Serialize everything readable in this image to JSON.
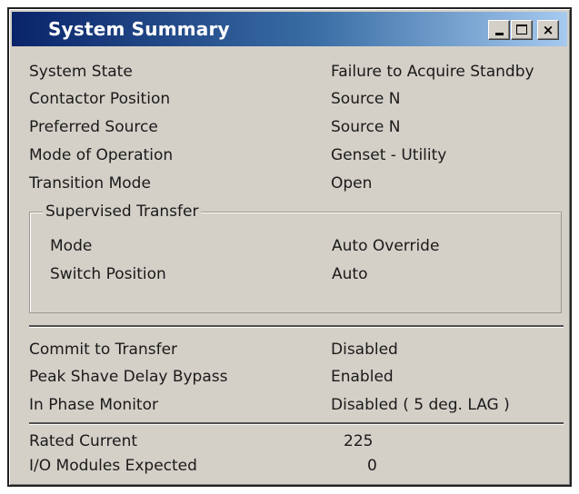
{
  "window": {
    "title": "System Summary",
    "controls": {
      "minimize": "minimize",
      "maximize": "maximize",
      "close": "×"
    }
  },
  "summary": [
    {
      "label": "System State",
      "value": "Failure to Acquire Standby"
    },
    {
      "label": "Contactor Position",
      "value": "Source N"
    },
    {
      "label": "Preferred Source",
      "value": "Source N"
    },
    {
      "label": "Mode of Operation",
      "value": "Genset - Utility"
    },
    {
      "label": "Transition Mode",
      "value": "Open"
    }
  ],
  "supervised_transfer": {
    "legend": "Supervised Transfer",
    "rows": [
      {
        "label": "Mode",
        "value": "Auto Override"
      },
      {
        "label": "Switch Position",
        "value": "Auto"
      }
    ]
  },
  "transfer_settings": [
    {
      "label": "Commit to Transfer",
      "value": "Disabled"
    },
    {
      "label": "Peak Shave Delay Bypass",
      "value": "Enabled"
    },
    {
      "label": "In Phase Monitor",
      "value": "Disabled ( 5 deg. LAG )"
    }
  ],
  "ratings": [
    {
      "label": "Rated Current",
      "value": "225"
    },
    {
      "label": "I/O Modules Expected",
      "value": "0"
    }
  ]
}
